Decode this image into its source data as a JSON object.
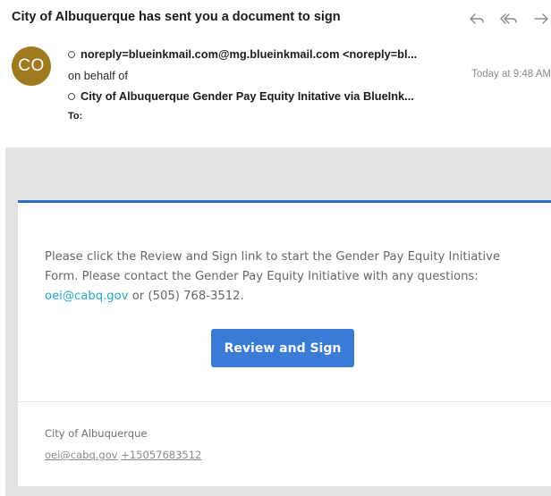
{
  "email": {
    "subject": "City of Albuquerque has sent you a document to sign",
    "avatar_initials": "CO",
    "sender": "noreply=blueinkmail.com@mg.blueinkmail.com <noreply=bl...",
    "on_behalf_label": "on behalf of",
    "behalf_name": "City of Albuquerque Gender Pay Equity Initative via BlueInk...",
    "to_label": "To:",
    "date": "Today at 9:48 AM"
  },
  "actions": {
    "reply_icon": "reply-icon",
    "reply_all_icon": "reply-all-icon",
    "forward_icon": "forward-icon"
  },
  "body": {
    "message": "Please click the Review and Sign link to start the Gender Pay Equity Initiative Form. Please contact the Gender Pay Equity Initiative with any questions:",
    "email_link": "oei@cabq.gov",
    "phone_text": " or (505) 768-3512.",
    "button_label": "Review and Sign"
  },
  "footer": {
    "org": "City of Albuquerque",
    "email_link": "oei@cabq.gov",
    "phone_link": "+15057683512"
  },
  "colors": {
    "avatar": "#a07a1e",
    "accent_bar": "#2c6bc4",
    "button": "#3a7bd5",
    "link": "#2aa6c8"
  }
}
